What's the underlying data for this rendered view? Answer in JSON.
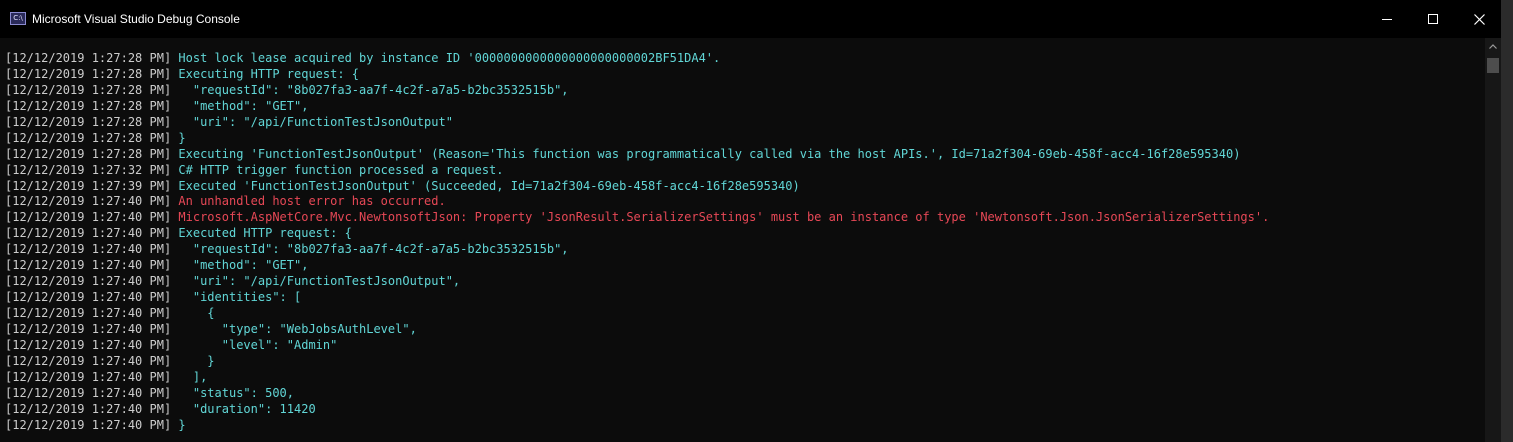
{
  "window": {
    "title": "Microsoft Visual Studio Debug Console",
    "icon_text": "C:\\",
    "controls": [
      "minimize-icon",
      "maximize-icon",
      "close-icon"
    ]
  },
  "colors": {
    "background": "#0c0c0c",
    "timestamp": "#cccccc",
    "info": "#61d6d6",
    "error": "#e74856"
  },
  "console": {
    "lines": [
      {
        "timestamp": "[12/12/2019 1:27:28 PM]",
        "text": " Host lock lease acquired by instance ID '0000000000000000000000002BF51DA4'.",
        "level": "cyan"
      },
      {
        "timestamp": "[12/12/2019 1:27:28 PM]",
        "text": " Executing HTTP request: {",
        "level": "cyan"
      },
      {
        "timestamp": "[12/12/2019 1:27:28 PM]",
        "text": "   \"requestId\": \"8b027fa3-aa7f-4c2f-a7a5-b2bc3532515b\",",
        "level": "cyan"
      },
      {
        "timestamp": "[12/12/2019 1:27:28 PM]",
        "text": "   \"method\": \"GET\",",
        "level": "cyan"
      },
      {
        "timestamp": "[12/12/2019 1:27:28 PM]",
        "text": "   \"uri\": \"/api/FunctionTestJsonOutput\"",
        "level": "cyan"
      },
      {
        "timestamp": "[12/12/2019 1:27:28 PM]",
        "text": " }",
        "level": "cyan"
      },
      {
        "timestamp": "[12/12/2019 1:27:28 PM]",
        "text": " Executing 'FunctionTestJsonOutput' (Reason='This function was programmatically called via the host APIs.', Id=71a2f304-69eb-458f-acc4-16f28e595340)",
        "level": "cyan"
      },
      {
        "timestamp": "[12/12/2019 1:27:32 PM]",
        "text": " C# HTTP trigger function processed a request.",
        "level": "cyan"
      },
      {
        "timestamp": "[12/12/2019 1:27:39 PM]",
        "text": " Executed 'FunctionTestJsonOutput' (Succeeded, Id=71a2f304-69eb-458f-acc4-16f28e595340)",
        "level": "cyan"
      },
      {
        "timestamp": "[12/12/2019 1:27:40 PM]",
        "text": " An unhandled host error has occurred.",
        "level": "red"
      },
      {
        "timestamp": "[12/12/2019 1:27:40 PM]",
        "text": " Microsoft.AspNetCore.Mvc.NewtonsoftJson: Property 'JsonResult.SerializerSettings' must be an instance of type 'Newtonsoft.Json.JsonSerializerSettings'.",
        "level": "red"
      },
      {
        "timestamp": "[12/12/2019 1:27:40 PM]",
        "text": " Executed HTTP request: {",
        "level": "cyan"
      },
      {
        "timestamp": "[12/12/2019 1:27:40 PM]",
        "text": "   \"requestId\": \"8b027fa3-aa7f-4c2f-a7a5-b2bc3532515b\",",
        "level": "cyan"
      },
      {
        "timestamp": "[12/12/2019 1:27:40 PM]",
        "text": "   \"method\": \"GET\",",
        "level": "cyan"
      },
      {
        "timestamp": "[12/12/2019 1:27:40 PM]",
        "text": "   \"uri\": \"/api/FunctionTestJsonOutput\",",
        "level": "cyan"
      },
      {
        "timestamp": "[12/12/2019 1:27:40 PM]",
        "text": "   \"identities\": [",
        "level": "cyan"
      },
      {
        "timestamp": "[12/12/2019 1:27:40 PM]",
        "text": "     {",
        "level": "cyan"
      },
      {
        "timestamp": "[12/12/2019 1:27:40 PM]",
        "text": "       \"type\": \"WebJobsAuthLevel\",",
        "level": "cyan"
      },
      {
        "timestamp": "[12/12/2019 1:27:40 PM]",
        "text": "       \"level\": \"Admin\"",
        "level": "cyan"
      },
      {
        "timestamp": "[12/12/2019 1:27:40 PM]",
        "text": "     }",
        "level": "cyan"
      },
      {
        "timestamp": "[12/12/2019 1:27:40 PM]",
        "text": "   ],",
        "level": "cyan"
      },
      {
        "timestamp": "[12/12/2019 1:27:40 PM]",
        "text": "   \"status\": 500,",
        "level": "cyan"
      },
      {
        "timestamp": "[12/12/2019 1:27:40 PM]",
        "text": "   \"duration\": 11420",
        "level": "cyan"
      },
      {
        "timestamp": "[12/12/2019 1:27:40 PM]",
        "text": " }",
        "level": "cyan"
      }
    ]
  }
}
